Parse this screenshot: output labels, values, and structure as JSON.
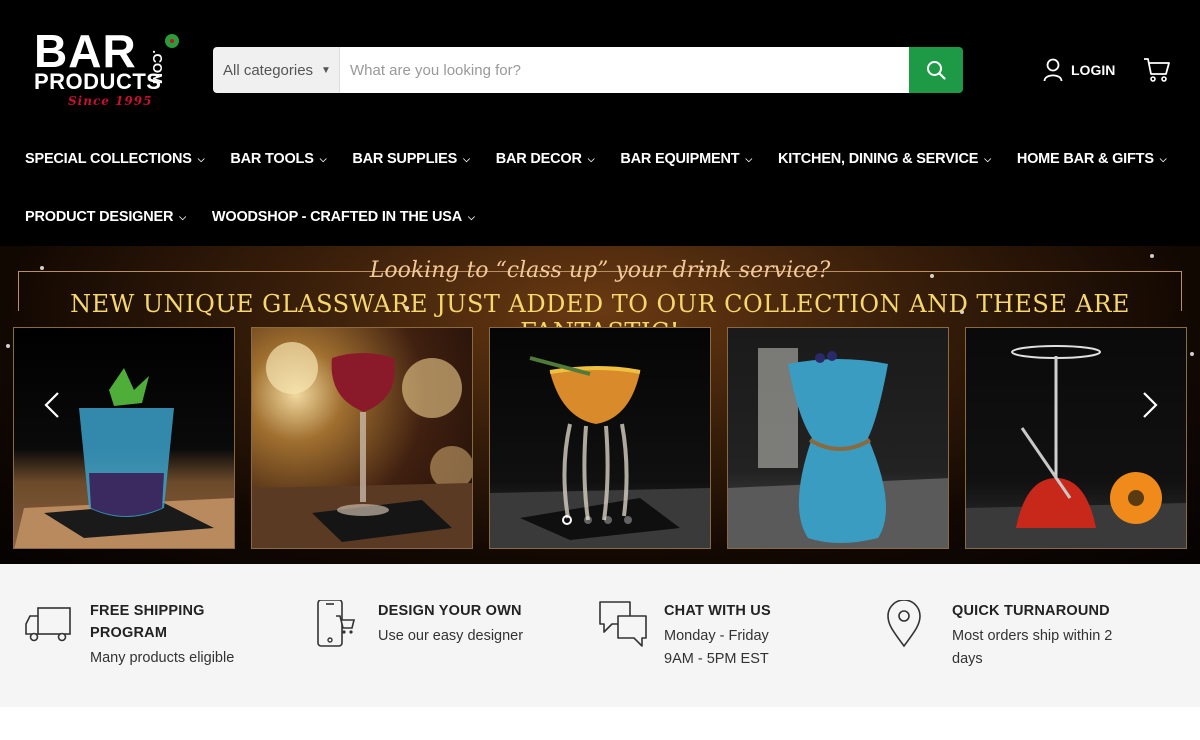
{
  "logo": {
    "bar": "BAR",
    "products": "PRODUCTS",
    "com": ".COM",
    "since": "Since 1995"
  },
  "search": {
    "category": "All categories",
    "placeholder": "What are you looking for?",
    "icon": "search-icon"
  },
  "account": {
    "login_label": "LOGIN",
    "icon": "user-icon",
    "cart_icon": "cart-icon"
  },
  "nav": {
    "row1": [
      {
        "label": "SPECIAL COLLECTIONS"
      },
      {
        "label": "BAR TOOLS"
      },
      {
        "label": "BAR SUPPLIES"
      },
      {
        "label": "BAR DECOR"
      },
      {
        "label": "BAR EQUIPMENT"
      },
      {
        "label": "KITCHEN, DINING & SERVICE"
      },
      {
        "label": "HOME BAR & GIFTS"
      }
    ],
    "row2": [
      {
        "label": "PRODUCT DESIGNER"
      },
      {
        "label": "WOODSHOP - CRAFTED IN THE USA"
      }
    ]
  },
  "hero": {
    "line1": "Looking to “class up” your drink service?",
    "line2": "NEW UNIQUE GLASSWARE JUST ADDED TO OUR COLLECTION AND THESE ARE FANTASTIC!",
    "slides": [
      "blue-cocktail-tumbler",
      "red-wine-stem-glass",
      "jellyfish-coupe-glass",
      "blue-bag-glass",
      "red-tilted-martini-glass"
    ],
    "active_slide": 1,
    "slide_count": 4
  },
  "features": [
    {
      "title_line1": "FREE SHIPPING",
      "title_line2": "PROGRAM",
      "text_line1": "Many products eligible",
      "text_line2": "",
      "icon": "truck-icon"
    },
    {
      "title_line1": "DESIGN YOUR OWN",
      "title_line2": "",
      "text_line1": "Use our easy designer",
      "text_line2": "",
      "icon": "phone-cart-icon"
    },
    {
      "title_line1": "CHAT WITH US",
      "title_line2": "",
      "text_line1": "Monday - Friday",
      "text_line2": "9AM - 5PM EST",
      "icon": "chat-icon"
    },
    {
      "title_line1": "QUICK TURNAROUND",
      "title_line2": "",
      "text_line1": "Most orders ship within 2",
      "text_line2": "days",
      "icon": "map-pin-icon"
    }
  ],
  "colors": {
    "header_bg": "#000000",
    "accent_green": "#1e9a46",
    "hero_gold": "#f5d76e",
    "logo_red": "#c8102e",
    "features_bg": "#f5f5f5"
  }
}
